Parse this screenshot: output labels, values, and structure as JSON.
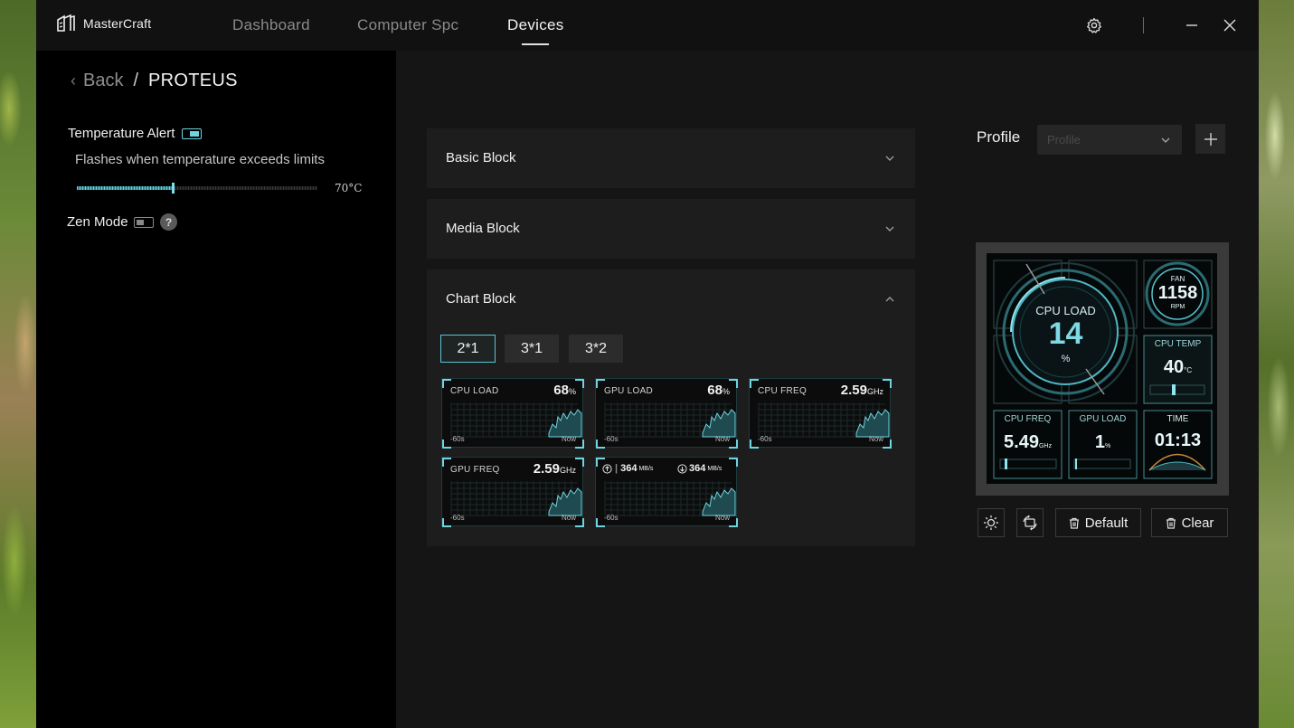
{
  "app": {
    "name": "MasterCraft",
    "tabs": [
      {
        "label": "Dashboard",
        "active": false
      },
      {
        "label": "Computer Spc",
        "active": false
      },
      {
        "label": "Devices",
        "active": true
      }
    ]
  },
  "breadcrumb": {
    "back": "Back",
    "separator": "/",
    "title": "PROTEUS"
  },
  "settings": {
    "temperature_alert": {
      "label": "Temperature Alert",
      "enabled": true,
      "description": "Flashes when temperature exceeds limits",
      "value_label": "70°C",
      "slider_fraction": 0.4
    },
    "zen_mode": {
      "label": "Zen Mode",
      "enabled": false,
      "help": "?"
    }
  },
  "blocks": [
    {
      "title": "Basic Block",
      "expanded": false
    },
    {
      "title": "Media Block",
      "expanded": false
    },
    {
      "title": "Chart Block",
      "expanded": true
    }
  ],
  "chart_block": {
    "layouts": [
      {
        "label": "2*1",
        "active": true
      },
      {
        "label": "3*1",
        "active": false
      },
      {
        "label": "3*2",
        "active": false
      }
    ],
    "widgets": [
      {
        "label": "CPU LOAD",
        "value": "68",
        "unit": "%",
        "left": "-60s",
        "right": "Now"
      },
      {
        "label": "GPU LOAD",
        "value": "68",
        "unit": "%",
        "left": "-60s",
        "right": "Now"
      },
      {
        "label": "CPU FREQ",
        "value": "2.59",
        "unit": "GHz",
        "left": "-60s",
        "right": "Now"
      },
      {
        "label": "GPU FREQ",
        "value": "2.59",
        "unit": "GHz",
        "left": "-60s",
        "right": "Now"
      }
    ],
    "network_widget": {
      "upload": "364",
      "download": "364",
      "unit": "MB/s",
      "left": "-60s",
      "right": "Now"
    }
  },
  "profile": {
    "label": "Profile",
    "placeholder": "Profile",
    "add": "+"
  },
  "preview": {
    "cpu_load": {
      "label": "CPU LOAD",
      "value": "14",
      "unit": "%"
    },
    "fan": {
      "label": "FAN",
      "value": "1158",
      "unit": "RPM"
    },
    "cpu_temp": {
      "label": "CPU TEMP",
      "value": "40",
      "unit": "°C"
    },
    "cpu_freq": {
      "label": "CPU FREQ",
      "value": "5.49",
      "unit": "GHz"
    },
    "gpu_load": {
      "label": "GPU LOAD",
      "value": "1",
      "unit": "%"
    },
    "time": {
      "label": "TIME",
      "value": "01:13"
    }
  },
  "actions": {
    "default": "Default",
    "clear": "Clear"
  },
  "colors": {
    "accent": "#6fd3e0",
    "panel": "#1d1d1d",
    "background": "#151515"
  }
}
